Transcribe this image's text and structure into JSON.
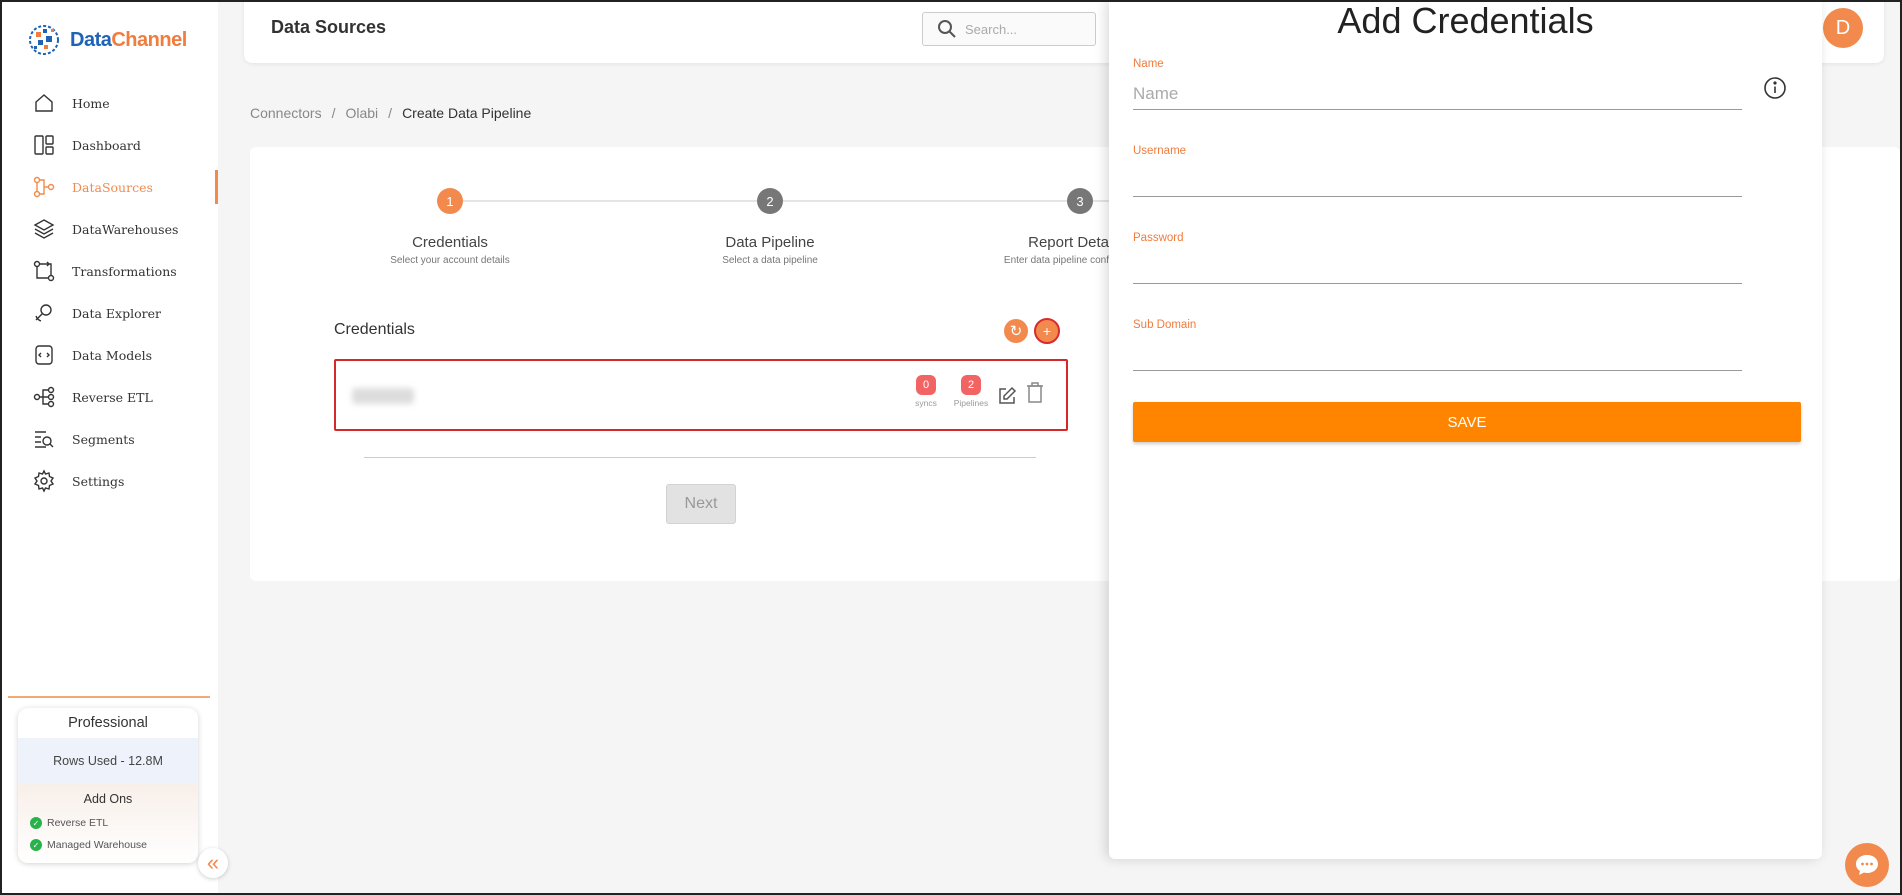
{
  "brand": {
    "name_part1": "Data",
    "name_part2": "Channel"
  },
  "sidebar": {
    "items": [
      {
        "label": "Home",
        "icon": "home-icon",
        "active": false
      },
      {
        "label": "Dashboard",
        "icon": "dashboard-icon",
        "active": false
      },
      {
        "label": "DataSources",
        "icon": "datasources-icon",
        "active": true
      },
      {
        "label": "DataWarehouses",
        "icon": "layers-icon",
        "active": false
      },
      {
        "label": "Transformations",
        "icon": "transform-icon",
        "active": false
      },
      {
        "label": "Data Explorer",
        "icon": "explorer-icon",
        "active": false
      },
      {
        "label": "Data Models",
        "icon": "models-icon",
        "active": false
      },
      {
        "label": "Reverse ETL",
        "icon": "reverse-etl-icon",
        "active": false
      },
      {
        "label": "Segments",
        "icon": "segments-icon",
        "active": false
      },
      {
        "label": "Settings",
        "icon": "gear-icon",
        "active": false
      }
    ],
    "plan": {
      "name": "Professional",
      "rows_used": "Rows Used - 12.8M",
      "addons_title": "Add Ons",
      "addons": [
        "Reverse ETL",
        "Managed Warehouse"
      ]
    },
    "collapse_glyph": "«"
  },
  "header": {
    "title": "Data Sources",
    "search_placeholder": "Search...",
    "avatar_initial": "D"
  },
  "breadcrumb": {
    "items": [
      "Connectors",
      "Olabi",
      "Create Data Pipeline"
    ],
    "separator": "/"
  },
  "stepper": {
    "steps": [
      {
        "number": "1",
        "title": "Credentials",
        "subtitle": "Select your account details",
        "state": "active"
      },
      {
        "number": "2",
        "title": "Data Pipeline",
        "subtitle": "Select a data pipeline",
        "state": "pending"
      },
      {
        "number": "3",
        "title": "Report Deta",
        "subtitle": "Enter data pipeline conf",
        "state": "pending"
      }
    ]
  },
  "credentials": {
    "heading": "Credentials",
    "refresh_glyph": "↻",
    "add_glyph": "+",
    "row": {
      "syncs_count": "0",
      "syncs_label": "syncs",
      "pipelines_count": "2",
      "pipelines_label": "Pipelines"
    },
    "next_label": "Next"
  },
  "drawer": {
    "title": "Add Credentials",
    "fields": [
      {
        "label": "Name",
        "placeholder": "Name",
        "value": ""
      },
      {
        "label": "Username",
        "placeholder": "",
        "value": ""
      },
      {
        "label": "Password",
        "placeholder": "",
        "value": ""
      },
      {
        "label": "Sub Domain",
        "placeholder": "",
        "value": ""
      }
    ],
    "save_label": "SAVE"
  },
  "colors": {
    "accent": "#f28a4d",
    "save": "#ff8400",
    "badge": "#f26464",
    "highlight_border": "#d62828",
    "brand_blue": "#1e63b5"
  }
}
